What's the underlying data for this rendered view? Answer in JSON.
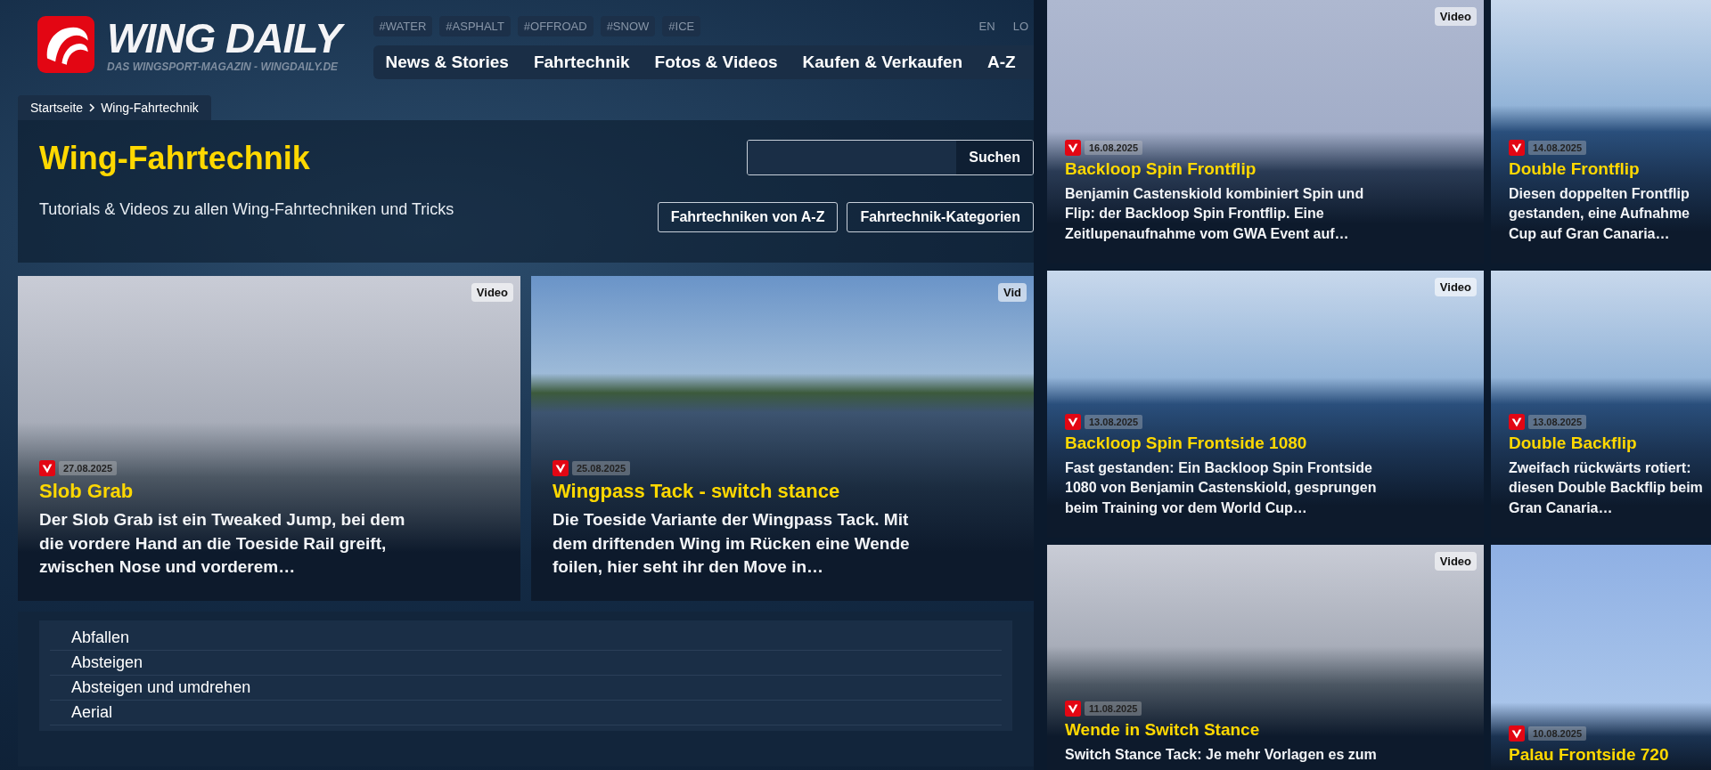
{
  "logo": {
    "name": "WING DAILY",
    "tagline": "DAS WINGSPORT-MAGAZIN - WINGDAILY.DE"
  },
  "tags": [
    "#WATER",
    "#ASPHALT",
    "#OFFROAD",
    "#SNOW",
    "#ICE"
  ],
  "lang_links": [
    "EN",
    "LO"
  ],
  "nav": [
    "News & Stories",
    "Fahrtechnik",
    "Fotos & Videos",
    "Kaufen & Verkaufen",
    "A-Z"
  ],
  "breadcrumb": [
    "Startseite",
    "Wing-Fahrtechnik"
  ],
  "header": {
    "title": "Wing-Fahrtechnik",
    "subtitle": "Tutorials & Videos zu allen Wing-Fahrtechniken und Tricks",
    "search_button": "Suchen",
    "buttons": [
      "Fahrtechniken von A-Z",
      "Fahrtechnik-Kategorien"
    ]
  },
  "cards": [
    {
      "badge": "Video",
      "date": "27.08.2025",
      "title": "Slob Grab",
      "lines": [
        "Der Slob Grab ist ein Tweaked Jump, bei dem",
        "die vordere Hand an die Toeside Rail greift,",
        "zwischen Nose und vorderem…"
      ]
    },
    {
      "badge": "Vid",
      "date": "25.08.2025",
      "title": "Wingpass Tack - switch stance",
      "lines": [
        "Die Toeside Variante der Wingpass Tack. Mit",
        "dem driftenden Wing im Rücken eine Wende",
        "foilen, hier seht ihr den Move in…"
      ]
    }
  ],
  "technique_list": [
    "Abfallen",
    "Absteigen",
    "Absteigen und umdrehen",
    "Aerial"
  ],
  "side_cards": [
    {
      "badge": "Video",
      "date": "16.08.2025",
      "title": "Backloop Spin Frontflip",
      "lines": [
        "Benjamin Castenskiold kombiniert Spin und",
        "Flip: der Backloop Spin Frontflip. Eine",
        "Zeitlupenaufnahme vom GWA Event auf…"
      ]
    },
    {
      "date": "14.08.2025",
      "title": "Double Frontflip",
      "lines": [
        "Diesen doppelten Frontflip",
        "gestanden, eine Aufnahme",
        "Cup auf Gran Canaria…"
      ]
    },
    {
      "badge": "Video",
      "date": "13.08.2025",
      "title": "Backloop Spin Frontside 1080",
      "lines": [
        "Fast gestanden: Ein Backloop Spin Frontside",
        "1080 von Benjamin Castenskiold, gesprungen",
        "beim Training vor dem World Cup…"
      ]
    },
    {
      "date": "13.08.2025",
      "title": "Double Backflip",
      "lines": [
        "Zweifach rückwärts rotiert:",
        "diesen Double Backflip beim",
        "Gran Canaria…"
      ]
    },
    {
      "badge": "Video",
      "date": "11.08.2025",
      "title": "Wende in Switch Stance",
      "lines": [
        "Switch Stance Tack: Je mehr Vorlagen es zum"
      ]
    },
    {
      "date": "10.08.2025",
      "title": "Palau Frontside 720"
    }
  ]
}
